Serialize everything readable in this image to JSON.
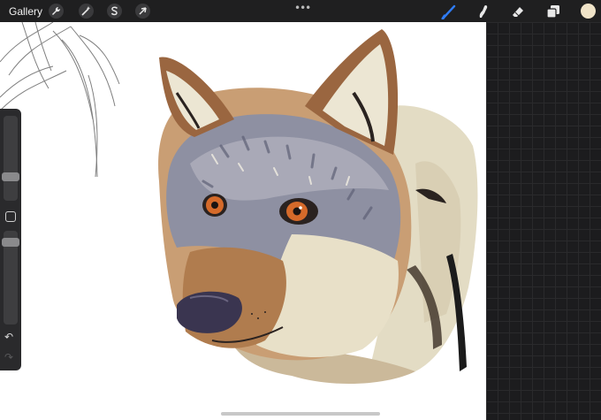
{
  "app": {
    "gallery_label": "Gallery",
    "more_label": "•••"
  },
  "toolbar_left": [
    {
      "name": "actions",
      "icon": "wrench-icon"
    },
    {
      "name": "adjustments",
      "icon": "magic-wand-icon"
    },
    {
      "name": "selection",
      "icon": "selection-s-icon"
    },
    {
      "name": "transform",
      "icon": "arrow-cursor-icon"
    }
  ],
  "toolbar_right": [
    {
      "name": "brush",
      "icon": "brush-icon",
      "active": true
    },
    {
      "name": "smudge",
      "icon": "smudge-icon"
    },
    {
      "name": "eraser",
      "icon": "eraser-icon"
    },
    {
      "name": "layers",
      "icon": "layers-icon"
    },
    {
      "name": "color",
      "icon": "color-swatch",
      "color": "#efe3c8"
    }
  ],
  "sidebar": {
    "brush_size_level": 0.4,
    "opacity_level": 0.9,
    "undo_icon": "undo-arrow-icon",
    "redo_icon": "redo-arrow-icon",
    "modify_icon": "square-modify-icon"
  },
  "colors": {
    "accent": "#2f7cf6",
    "toolbar_bg": "#1f1f20",
    "canvas": "#ffffff"
  }
}
